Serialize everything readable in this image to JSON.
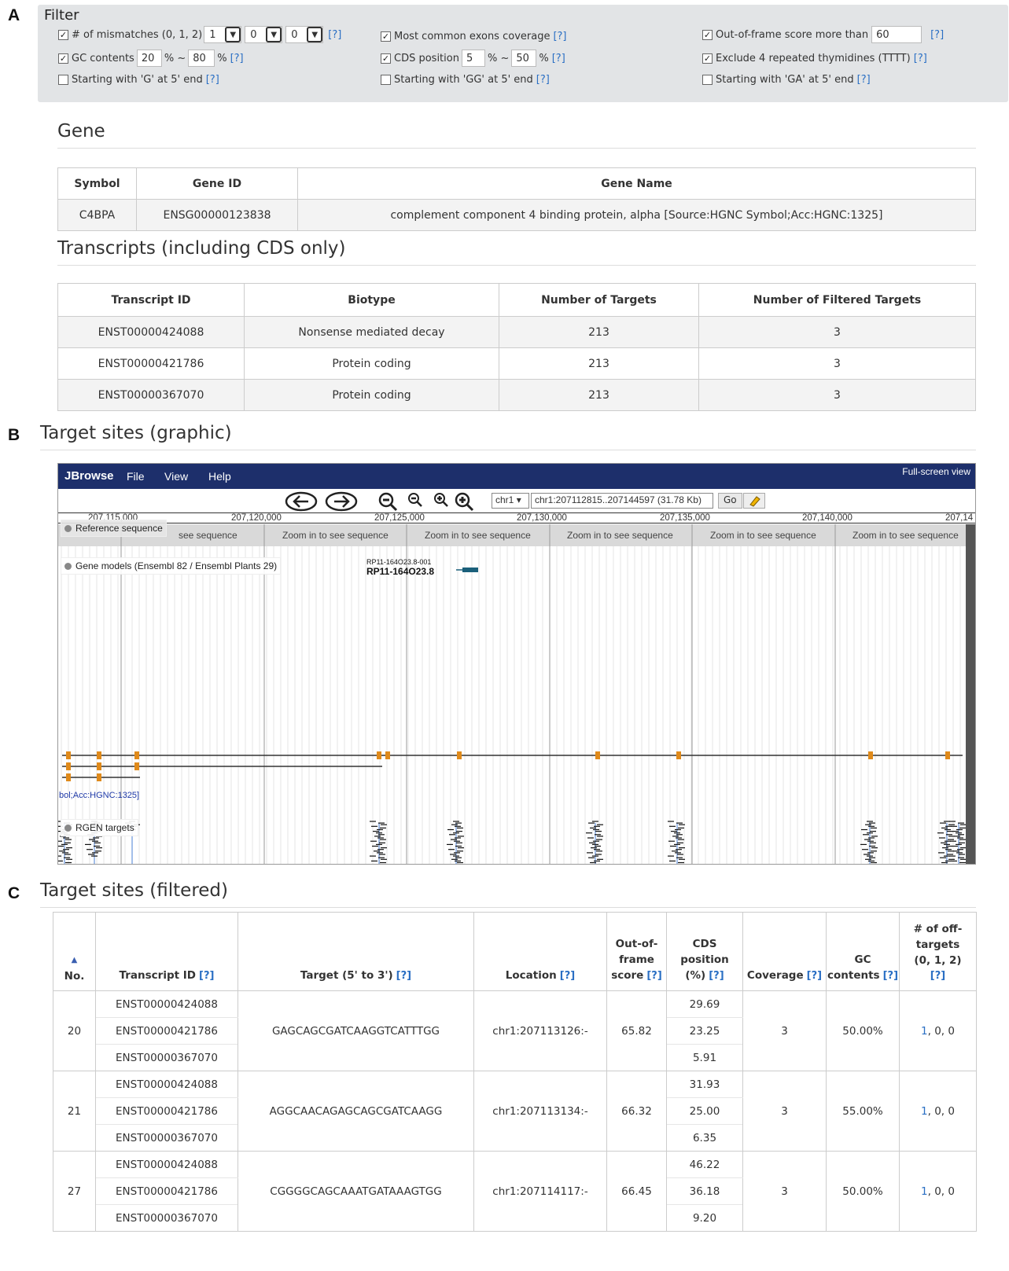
{
  "panels": {
    "a": "A",
    "b": "B",
    "c": "C"
  },
  "filter": {
    "title": "Filter",
    "mismatch": {
      "label": "# of mismatches (0, 1, 2)",
      "v1": "1",
      "v2": "0",
      "v3": "0",
      "help": "[?]"
    },
    "gc": {
      "label": "GC contents",
      "min": "20",
      "sep": "% ~",
      "max": "80",
      "unit": "%",
      "help": "[?]"
    },
    "g5": {
      "label": "Starting with 'G' at 5' end",
      "help": "[?]"
    },
    "exons": {
      "label": "Most common exons coverage",
      "help": "[?]"
    },
    "cds": {
      "label": "CDS position",
      "min": "5",
      "sep": "% ~",
      "max": "50",
      "unit": "%",
      "help": "[?]"
    },
    "gg5": {
      "label": "Starting with 'GG' at 5' end",
      "help": "[?]"
    },
    "oof": {
      "label": "Out-of-frame score more than",
      "value": "60",
      "help": "[?]"
    },
    "tttt": {
      "label": "Exclude 4 repeated thymidines (TTTT)",
      "help": "[?]"
    },
    "ga5": {
      "label": "Starting with 'GA' at 5' end",
      "help": "[?]"
    },
    "check_mark": "✓"
  },
  "gene": {
    "heading": "Gene",
    "headers": [
      "Symbol",
      "Gene ID",
      "Gene Name"
    ],
    "row": [
      "C4BPA",
      "ENSG00000123838",
      "complement component 4 binding protein, alpha [Source:HGNC Symbol;Acc:HGNC:1325]"
    ]
  },
  "transcripts": {
    "heading": "Transcripts (including CDS only)",
    "headers": [
      "Transcript ID",
      "Biotype",
      "Number of Targets",
      "Number of Filtered Targets"
    ],
    "rows": [
      [
        "ENST00000424088",
        "Nonsense mediated decay",
        "213",
        "3"
      ],
      [
        "ENST00000421786",
        "Protein coding",
        "213",
        "3"
      ],
      [
        "ENST00000367070",
        "Protein coding",
        "213",
        "3"
      ]
    ]
  },
  "graphic": {
    "heading": "Target sites (graphic)",
    "menu": {
      "brand": "JBrowse",
      "file": "File",
      "view": "View",
      "help": "Help",
      "fullscreen": "Full-screen view"
    },
    "chrom": "chr1",
    "location": "chr1:207112815..207144597 (31.78 Kb)",
    "go": "Go",
    "ruler": [
      "207,115,000",
      "207,120,000",
      "207,125,000",
      "207,130,000",
      "207,135,000",
      "207,140,000",
      "207,14"
    ],
    "zoom_text": "Zoom in to see sequence",
    "zoom_text_partial": "see sequence",
    "ref_label": "Reference sequence",
    "gene_models_label": "Gene models (Ensembl 82 / Ensembl Plants 29)",
    "gene_small": "RP11-164O23.8-001",
    "gene_big": "RP11-164O23.8",
    "hgnc_text": "bol;Acc:HGNC:1325]",
    "rgen_label": "RGEN targets"
  },
  "filtered": {
    "heading": "Target sites (filtered)",
    "headers": {
      "no": "No.",
      "tid": "Transcript ID",
      "target": "Target (5' to 3')",
      "location": "Location",
      "oof1": "Out-of-",
      "oof2": "frame",
      "oof3": "score",
      "cds1": "CDS",
      "cds2": "position",
      "cds3": "(%)",
      "coverage": "Coverage",
      "gc1": "GC",
      "gc2": "contents",
      "off1": "# of off-",
      "off2": "targets",
      "off3": "(0, 1, 2)",
      "help": "[?]"
    },
    "rows": [
      {
        "no": "20",
        "tids": [
          "ENST00000424088",
          "ENST00000421786",
          "ENST00000367070"
        ],
        "target": "GAGCAGCGATCAAGGTCATTTGG",
        "location": "chr1:207113126:-",
        "oof": "65.82",
        "cds": [
          "29.69",
          "23.25",
          "5.91"
        ],
        "coverage": "3",
        "gc": "50.00%",
        "off_link": "1",
        "off_rest": ", 0, 0"
      },
      {
        "no": "21",
        "tids": [
          "ENST00000424088",
          "ENST00000421786",
          "ENST00000367070"
        ],
        "target": "AGGCAACAGAGCAGCGATCAAGG",
        "location": "chr1:207113134:-",
        "oof": "66.32",
        "cds": [
          "31.93",
          "25.00",
          "6.35"
        ],
        "coverage": "3",
        "gc": "55.00%",
        "off_link": "1",
        "off_rest": ", 0, 0"
      },
      {
        "no": "27",
        "tids": [
          "ENST00000424088",
          "ENST00000421786",
          "ENST00000367070"
        ],
        "target": "CGGGGCAGCAAATGATAAAGTGG",
        "location": "chr1:207114117:-",
        "oof": "66.45",
        "cds": [
          "46.22",
          "36.18",
          "9.20"
        ],
        "coverage": "3",
        "gc": "50.00%",
        "off_link": "1",
        "off_rest": ", 0, 0"
      }
    ]
  },
  "colors": {
    "accent": "#2a6fc4",
    "jbrowse_bar": "#1d2f6b",
    "exon": "#e08a1a",
    "gene_feature": "#1a5f7a",
    "target_line": "#4a7fd4"
  }
}
